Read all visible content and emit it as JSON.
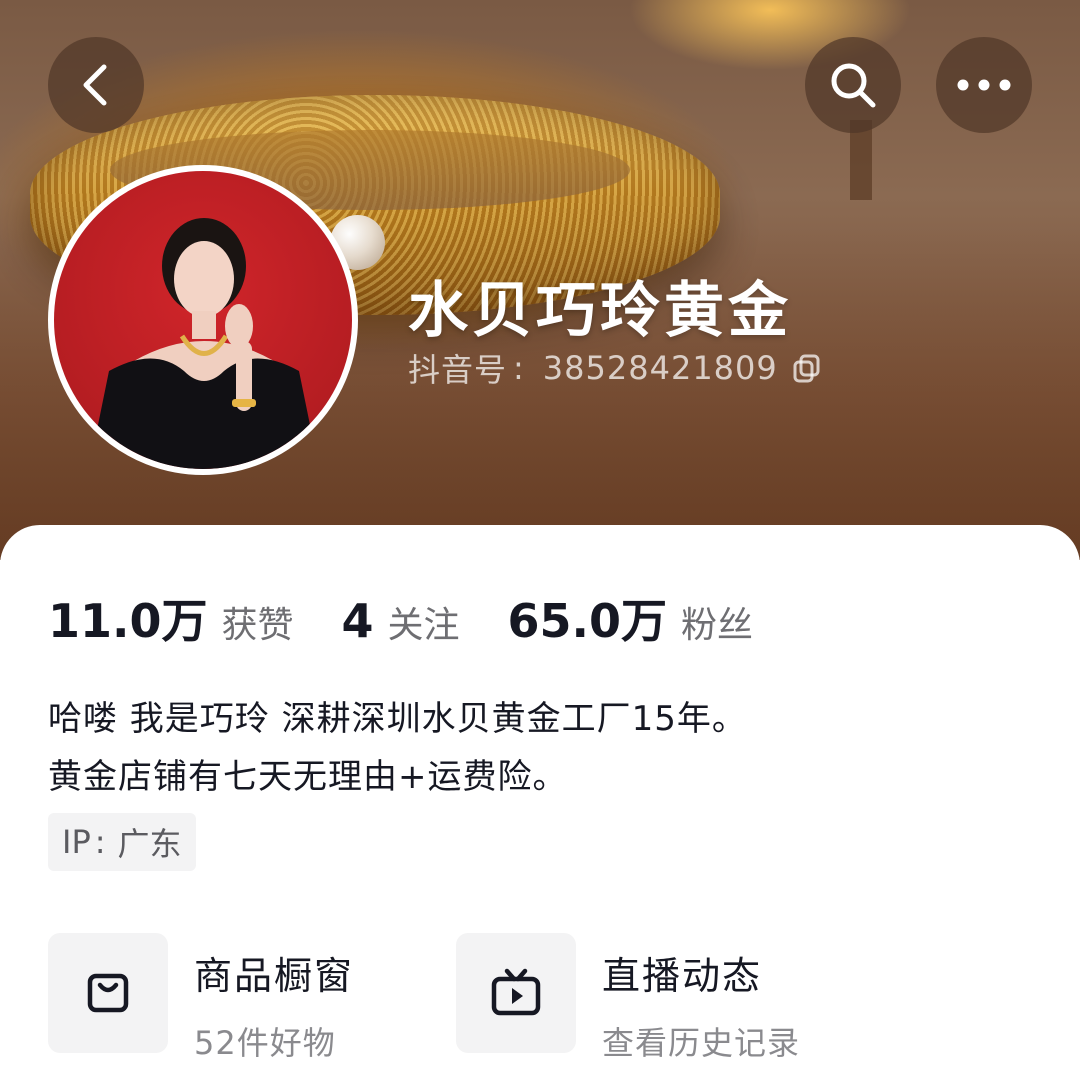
{
  "header": {
    "icons": {
      "back": "chevron-left-icon",
      "search": "search-icon",
      "more": "more-dots-icon"
    }
  },
  "profile": {
    "name": "水贝巧玲黄金",
    "douyin_id_label": "抖音号",
    "douyin_id_sep": ":",
    "douyin_id": "38528421809",
    "avatar_bg": "#c41f25"
  },
  "stats": [
    {
      "value": "11.0万",
      "label": "获赞"
    },
    {
      "value": "4",
      "label": "关注"
    },
    {
      "value": "65.0万",
      "label": "粉丝"
    }
  ],
  "bio": {
    "line1": "哈喽 我是巧玲 深耕深圳水贝黄金工厂15年。",
    "line2": "黄金店铺有七天无理由+运费险。"
  },
  "ip": {
    "label": "IP",
    "sep": ":",
    "value": "广东"
  },
  "features": {
    "shop": {
      "title": "商品橱窗",
      "subtitle": "52件好物",
      "icon": "shopping-bag-icon"
    },
    "live": {
      "title": "直播动态",
      "subtitle": "查看历史记录",
      "icon": "tv-play-icon"
    }
  },
  "colors": {
    "text_primary": "#161823",
    "text_secondary": "#6e6e72",
    "tag_bg": "#f3f3f4"
  }
}
